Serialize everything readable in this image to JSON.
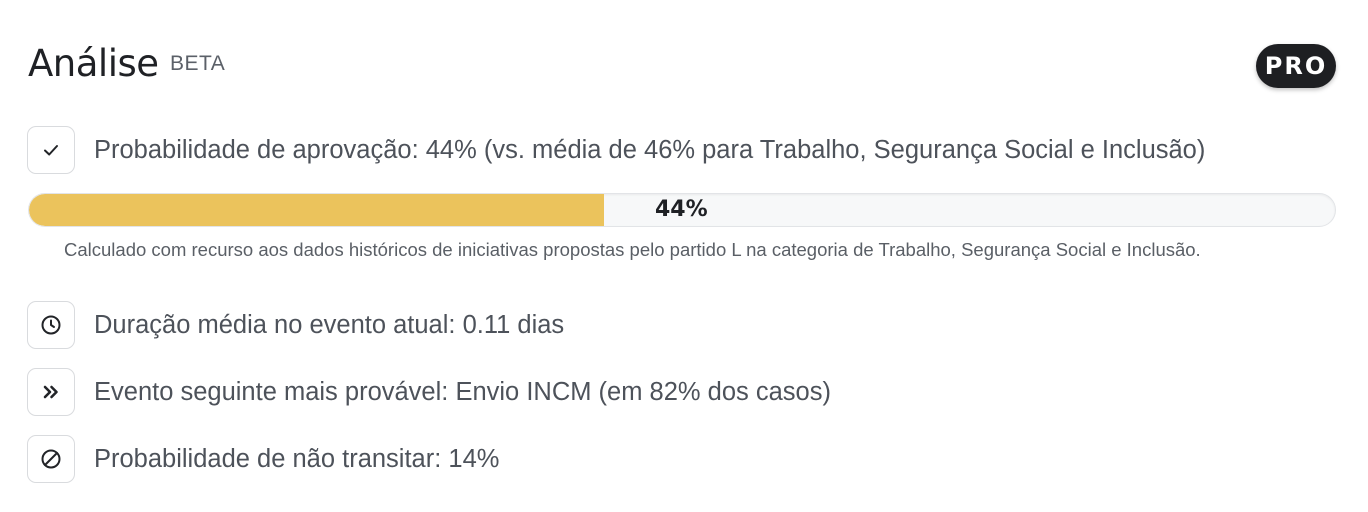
{
  "header": {
    "title": "Análise",
    "beta_label": "BETA",
    "pro_badge": "PRO"
  },
  "approval": {
    "icon": "check-icon",
    "text": "Probabilidade de aprovação: 44% (vs. média de 46% para Trabalho, Segurança Social e Inclusão)",
    "progress_value": 44,
    "progress_label": "44%",
    "progress_color": "#ebc35c",
    "footnote": "Calculado com recurso aos dados históricos de iniciativas propostas pelo partido L na categoria de Trabalho, Segurança Social e Inclusão."
  },
  "stats": [
    {
      "icon": "clock-icon",
      "text": "Duração média no evento atual: 0.11 dias"
    },
    {
      "icon": "double-chevron-right-icon",
      "text": "Evento seguinte mais provável: Envio INCM (em 82% dos casos)"
    },
    {
      "icon": "prohibited-icon",
      "text": "Probabilidade de não transitar: 14%"
    }
  ]
}
